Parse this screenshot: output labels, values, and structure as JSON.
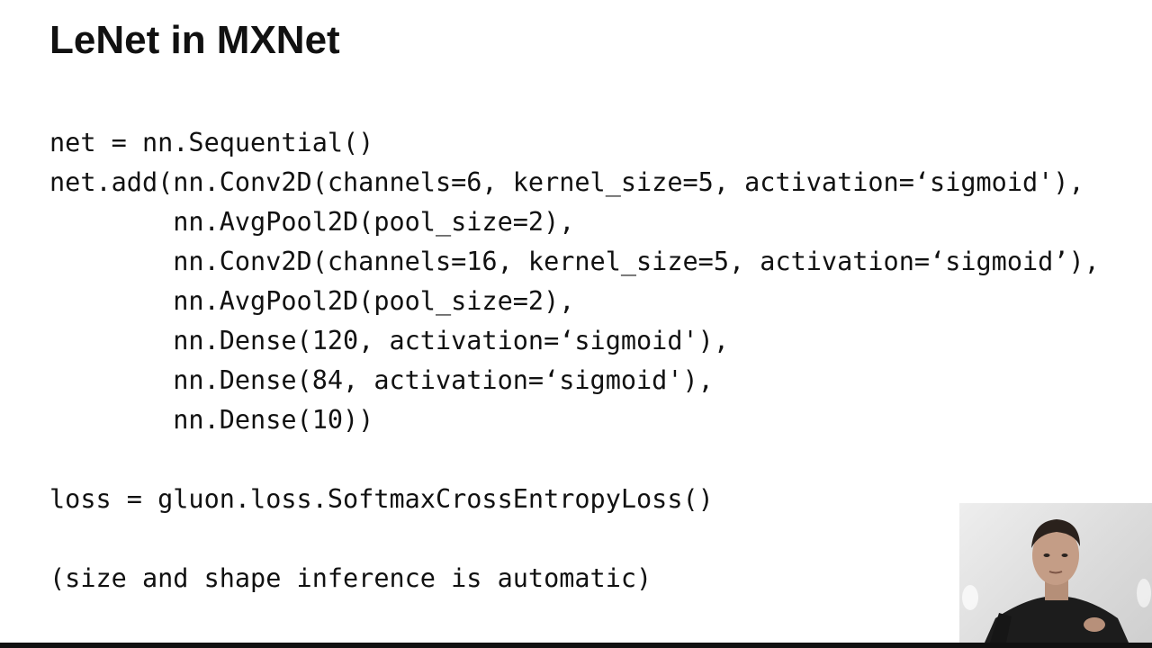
{
  "slide": {
    "title": "LeNet in MXNet",
    "code_lines": [
      "net = nn.Sequential()",
      "net.add(nn.Conv2D(channels=6, kernel_size=5, activation=‘sigmoid'),",
      "        nn.AvgPool2D(pool_size=2),",
      "        nn.Conv2D(channels=16, kernel_size=5, activation=‘sigmoid’),",
      "        nn.AvgPool2D(pool_size=2),",
      "        nn.Dense(120, activation=‘sigmoid'),",
      "        nn.Dense(84, activation=‘sigmoid'),",
      "        nn.Dense(10))",
      "",
      "loss = gluon.loss.SoftmaxCrossEntropyLoss()",
      "",
      "(size and shape inference is automatic)"
    ]
  },
  "colors": {
    "text": "#111111",
    "background": "#ffffff",
    "bottom_bar": "#111111"
  }
}
